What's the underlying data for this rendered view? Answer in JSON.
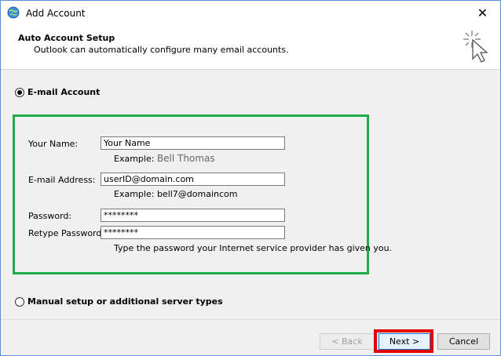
{
  "window": {
    "title": "Add Account",
    "close_glyph": "✕"
  },
  "header": {
    "title": "Auto Account Setup",
    "subtitle": "Outlook can automatically configure many email accounts."
  },
  "options": {
    "email_account": {
      "label": "E-mail Account",
      "selected": true
    },
    "manual_setup": {
      "label": "Manual setup or additional server types",
      "selected": false
    }
  },
  "form": {
    "name": {
      "label": "Your Name:",
      "value": "Your Name",
      "example_prefix": "Example:",
      "example_value": "Bell Thomas"
    },
    "email": {
      "label": "E-mail Address:",
      "value": "userID@domain.com",
      "example_prefix": "Example:",
      "example_value": "bell7@domaincom"
    },
    "password": {
      "label": "Password:",
      "value": "********"
    },
    "retype_password": {
      "label": "Retype Password:",
      "value": "********"
    },
    "hint": "Type the password your Internet service provider has given you."
  },
  "buttons": {
    "back": "< Back",
    "next": "Next >",
    "cancel": "Cancel"
  },
  "colors": {
    "highlight_green": "#1fad4b",
    "highlight_red": "#e50000"
  }
}
